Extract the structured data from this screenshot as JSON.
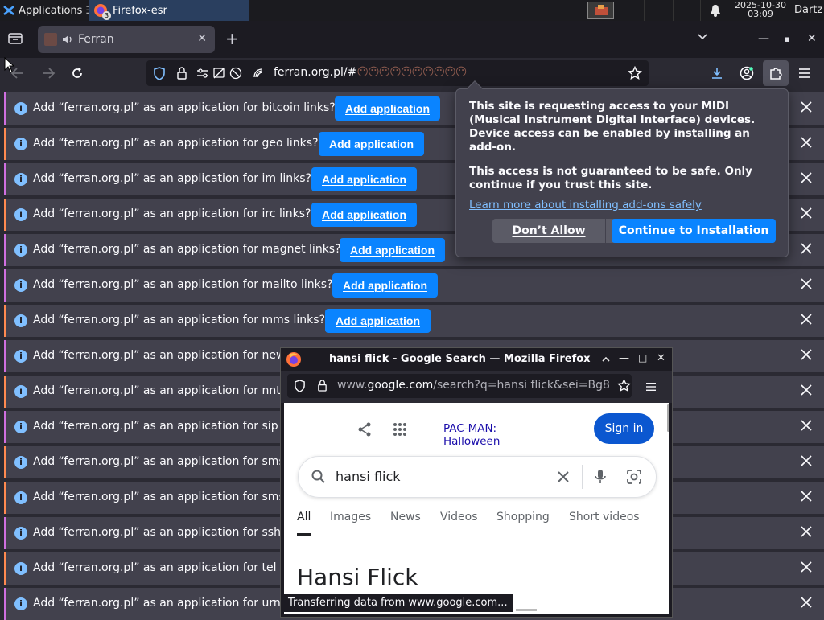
{
  "taskbar": {
    "applications_label": "Applications",
    "active_task": "Firefox-esr",
    "task_badge": "3",
    "date": "2025-10-30",
    "time": "03:09",
    "user": "Dartz"
  },
  "tabs": [
    {
      "label": "Ferran"
    }
  ],
  "urlbar": {
    "url": "ferran.org.pl/#",
    "url_emoji": "😶😶😶😶😶😶😶😶😶😶"
  },
  "notifications": [
    {
      "message": "Add “ferran.org.pl” as an application for bitcoin links?",
      "button": "Add application",
      "accent": "#d06fe0"
    },
    {
      "message": "Add “ferran.org.pl” as an application for geo links?",
      "button": "Add application",
      "accent": "#ff8a50"
    },
    {
      "message": "Add “ferran.org.pl” as an application for im links?",
      "button": "Add application",
      "accent": "#d06fe0"
    },
    {
      "message": "Add “ferran.org.pl” as an application for irc links?",
      "button": "Add application",
      "accent": "#ff8a50"
    },
    {
      "message": "Add “ferran.org.pl” as an application for magnet links?",
      "button": "Add application",
      "accent": "#d06fe0"
    },
    {
      "message": "Add “ferran.org.pl” as an application for mailto links?",
      "button": "Add application",
      "accent": "#d06fe0"
    },
    {
      "message": "Add “ferran.org.pl” as an application for mms links?",
      "button": "Add application",
      "accent": "#ff8a50"
    },
    {
      "message": "Add “ferran.org.pl” as an application for news",
      "button": "",
      "accent": "#d06fe0"
    },
    {
      "message": "Add “ferran.org.pl” as an application for nntp l",
      "button": "",
      "accent": "#ff8a50"
    },
    {
      "message": "Add “ferran.org.pl” as an application for sip lin",
      "button": "",
      "accent": "#d06fe0"
    },
    {
      "message": "Add “ferran.org.pl” as an application for sms li",
      "button": "",
      "accent": "#ff8a50"
    },
    {
      "message": "Add “ferran.org.pl” as an application for smsto",
      "button": "",
      "accent": "#ff8a50"
    },
    {
      "message": "Add “ferran.org.pl” as an application for ssh lin",
      "button": "",
      "accent": "#d06fe0"
    },
    {
      "message": "Add “ferran.org.pl” as an application for tel lin",
      "button": "",
      "accent": "#ff8a50"
    },
    {
      "message": "Add “ferran.org.pl” as an application for urn lin",
      "button": "",
      "accent": "#d06fe0"
    }
  ],
  "midi_popup": {
    "para1": "This site is requesting access to your MIDI (Musical Instrument Digital Interface) devices. Device access can be enabled by installing an add-on.",
    "para2": "This access is not guaranteed to be safe. Only continue if you trust this site.",
    "learn_more": "Learn more about installing add-ons safely",
    "dont_allow": "Don’t Allow",
    "continue": "Continue to Installation"
  },
  "window2": {
    "title": "hansi flick - Google Search — Mozilla Firefox",
    "url_prefix": "www.",
    "url_domain": "google.com",
    "url_rest": "/search?q=hansi flick&sei=Bg8",
    "status": "Transferring data from www.google.com...",
    "google": {
      "doodle": "PAC-MAN: Halloween",
      "signin": "Sign in",
      "query": "hansi flick",
      "tabs": [
        "All",
        "Images",
        "News",
        "Videos",
        "Shopping",
        "Short videos"
      ],
      "heading": "Hansi Flick"
    }
  },
  "colors": {
    "accent_blue": "#0a84ff",
    "google_blue": "#0b57d0"
  }
}
